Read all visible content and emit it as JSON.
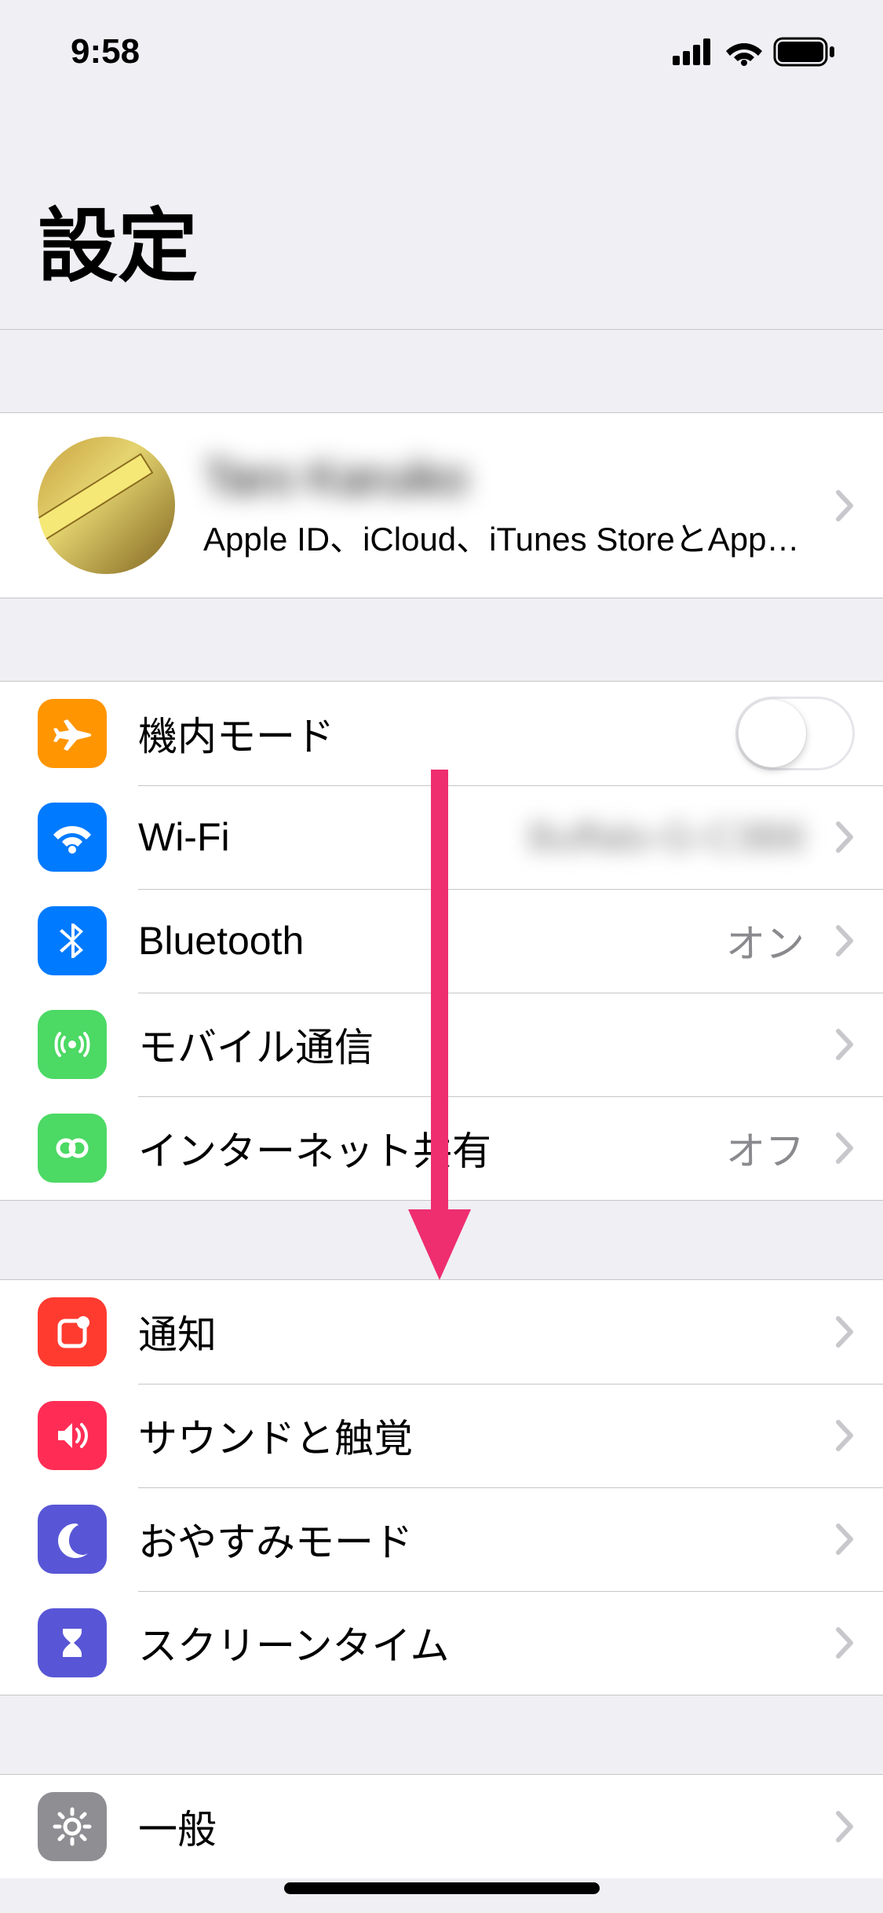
{
  "status": {
    "time": "9:58"
  },
  "title": "設定",
  "profile": {
    "name": "Taro Karuiko",
    "subtitle": "Apple ID、iCloud、iTunes StoreとApp S..."
  },
  "groups": [
    {
      "items": [
        {
          "id": "airplane",
          "label": "機内モード",
          "toggle": false
        },
        {
          "id": "wifi",
          "label": "Wi-Fi",
          "value": "Buffalo-G-C3B8",
          "valueBlurred": true
        },
        {
          "id": "bluetooth",
          "label": "Bluetooth",
          "value": "オン"
        },
        {
          "id": "cellular",
          "label": "モバイル通信"
        },
        {
          "id": "hotspot",
          "label": "インターネット共有",
          "value": "オフ"
        }
      ]
    },
    {
      "items": [
        {
          "id": "notifications",
          "label": "通知"
        },
        {
          "id": "sounds",
          "label": "サウンドと触覚"
        },
        {
          "id": "dnd",
          "label": "おやすみモード"
        },
        {
          "id": "screentime",
          "label": "スクリーンタイム"
        }
      ]
    },
    {
      "items": [
        {
          "id": "general",
          "label": "一般"
        }
      ]
    }
  ]
}
